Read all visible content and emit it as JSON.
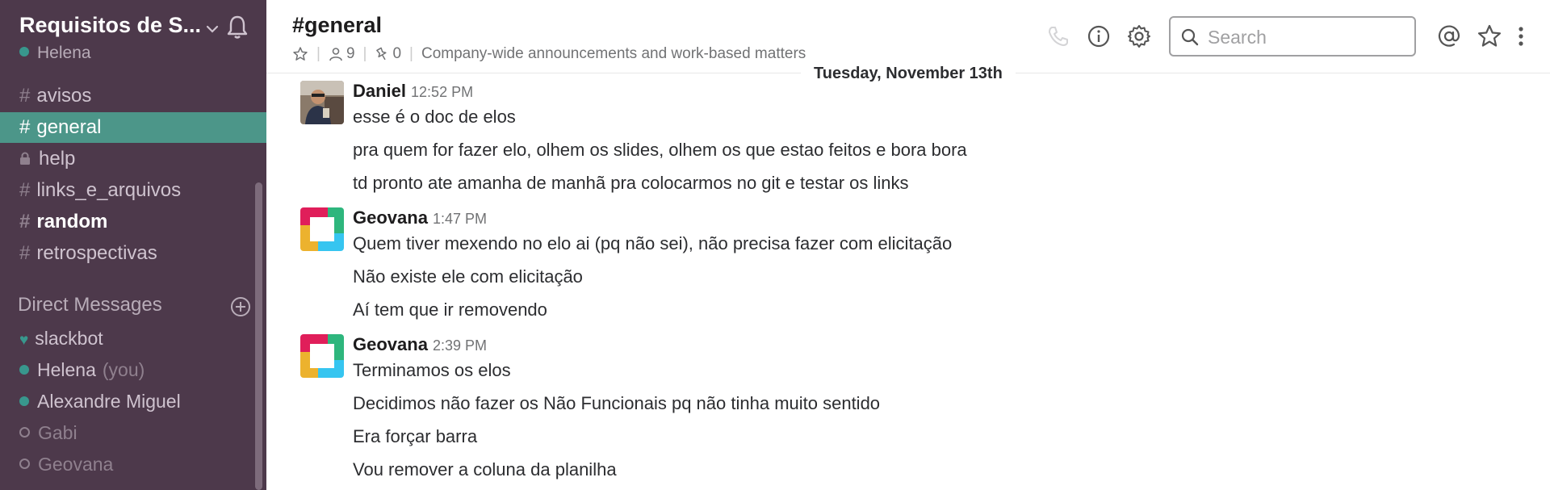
{
  "workspace": {
    "name": "Requisitos de S...",
    "current_user": "Helena"
  },
  "channels": [
    {
      "prefix": "#",
      "label": "avisos"
    },
    {
      "prefix": "#",
      "label": "general"
    },
    {
      "prefix": "lock",
      "label": "help"
    },
    {
      "prefix": "#",
      "label": "links_e_arquivos"
    },
    {
      "prefix": "#",
      "label": "random"
    },
    {
      "prefix": "#",
      "label": "retrospectivas"
    }
  ],
  "direct_messages": {
    "header": "Direct Messages",
    "items": [
      {
        "label": "slackbot"
      },
      {
        "label": "Helena",
        "suffix": "(you)"
      },
      {
        "label": "Alexandre Miguel"
      },
      {
        "label": "Gabi"
      },
      {
        "label": "Geovana"
      }
    ]
  },
  "channel_header": {
    "title": "#general",
    "members": "9",
    "pins": "0",
    "topic": "Company-wide announcements and work-based matters"
  },
  "search": {
    "placeholder": "Search"
  },
  "day_divider": "Tuesday, November 13th",
  "messages": [
    {
      "author": "Daniel",
      "time": "12:52 PM",
      "lines": [
        "esse é o doc de elos",
        "pra quem for fazer elo, olhem os slides, olhem os que estao feitos e bora bora",
        "td pronto ate amanha de manhã pra colocarmos no git e testar os links"
      ]
    },
    {
      "author": "Geovana",
      "time": "1:47 PM",
      "lines": [
        "Quem tiver mexendo no elo ai (pq não sei), não precisa fazer com elicitação",
        "Não existe ele com elicitação",
        "Aí tem que ir removendo"
      ]
    },
    {
      "author": "Geovana",
      "time": "2:39 PM",
      "lines": [
        "Terminamos os elos",
        "Decidimos não fazer os Não Funcionais pq não tinha muito sentido",
        "Era forçar barra",
        "Vou remover a coluna da planilha"
      ]
    }
  ],
  "colors": {
    "sidebar_bg": "#4d394b",
    "active_channel": "#4c9689",
    "presence_online": "#38978d"
  }
}
